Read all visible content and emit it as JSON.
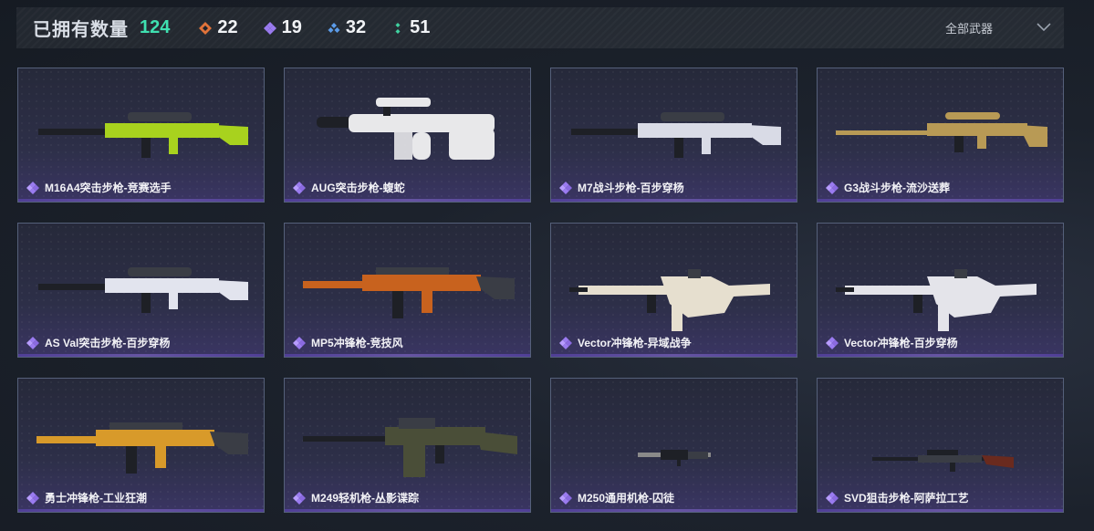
{
  "header": {
    "title": "已拥有数量",
    "total": "124",
    "stats": [
      {
        "icon": "orange-diamond-icon",
        "value": "22",
        "color": "#e0733a"
      },
      {
        "icon": "purple-diamond-icon",
        "value": "19",
        "color": "#9a7bf0"
      },
      {
        "icon": "blue-diamond-icon",
        "value": "32",
        "color": "#5b9be8"
      },
      {
        "icon": "green-dots-icon",
        "value": "51",
        "color": "#3fd2a0"
      }
    ],
    "filter": {
      "label": "全部武器",
      "icon": "chevron-down-icon"
    }
  },
  "colors": {
    "accent_purple": "#9a7bf0",
    "count_green": "#3fe0b0"
  },
  "weapons": [
    {
      "name": "M16A4突击步枪-竞赛选手",
      "rarity": "purple",
      "skin": "#a8d21e",
      "style": "rifle"
    },
    {
      "name": "AUG突击步枪-蝮蛇",
      "rarity": "purple",
      "skin": "#e8e8ea",
      "style": "bullpup"
    },
    {
      "name": "M7战斗步枪-百步穿杨",
      "rarity": "purple",
      "skin": "#d9dbe6",
      "style": "rifle"
    },
    {
      "name": "G3战斗步枪-流沙送葬",
      "rarity": "purple",
      "skin": "#b89a55",
      "style": "marksman"
    },
    {
      "name": "AS Val突击步枪-百步穿杨",
      "rarity": "purple",
      "skin": "#e2e4ee",
      "style": "rifle"
    },
    {
      "name": "MP5冲锋枪-竞技风",
      "rarity": "purple",
      "skin": "#c8621e",
      "style": "smg"
    },
    {
      "name": "Vector冲锋枪-异域战争",
      "rarity": "purple",
      "skin": "#e6dfcf",
      "style": "vector"
    },
    {
      "name": "Vector冲锋枪-百步穿杨",
      "rarity": "purple",
      "skin": "#e4e4ea",
      "style": "vector"
    },
    {
      "name": "勇士冲锋枪-工业狂潮",
      "rarity": "purple",
      "skin": "#d89a2a",
      "style": "smg"
    },
    {
      "name": "M249轻机枪-丛影谍踪",
      "rarity": "purple",
      "skin": "#4a4e38",
      "style": "lmg"
    },
    {
      "name": "M250通用机枪-囚徒",
      "rarity": "purple",
      "skin": "#8a8a8a",
      "style": "small"
    },
    {
      "name": "SVD狙击步枪-阿萨拉工艺",
      "rarity": "purple",
      "skin": "#6a2a1e",
      "style": "sniper"
    }
  ]
}
